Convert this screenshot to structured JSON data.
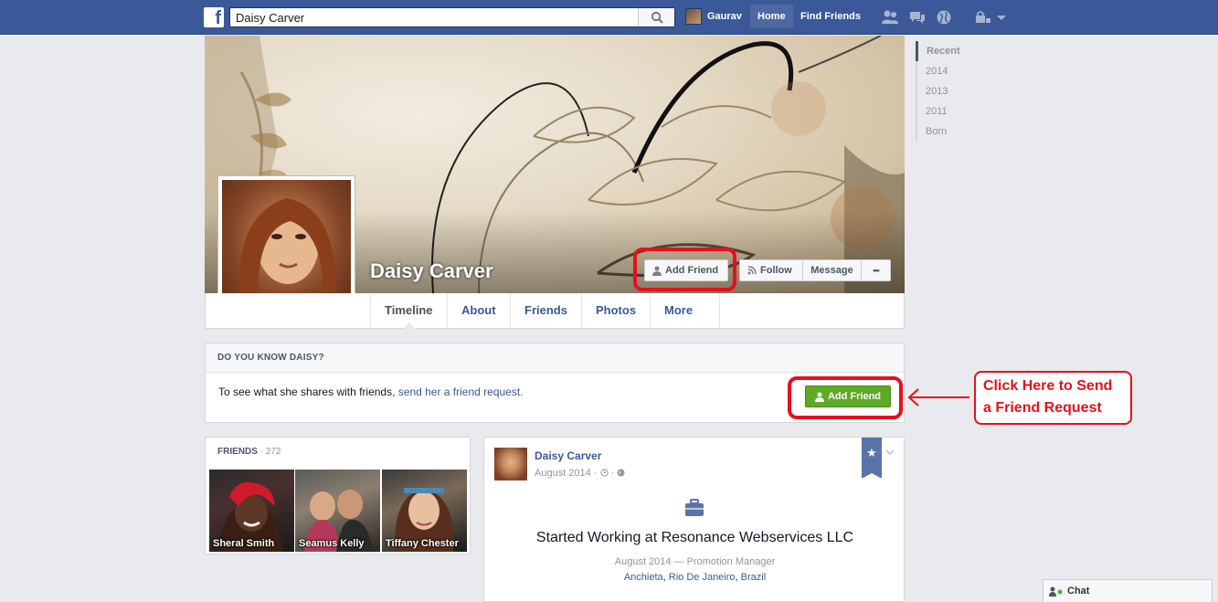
{
  "topbar": {
    "logo": "f",
    "search_value": "Daisy Carver",
    "user_name": "Gaurav",
    "home_label": "Home",
    "find_friends_label": "Find Friends"
  },
  "profile": {
    "name": "Daisy Carver",
    "cover_buttons": {
      "add_friend": "Add Friend",
      "follow": "Follow",
      "message": "Message",
      "more_dots": "•••"
    }
  },
  "tabs": {
    "timeline": "Timeline",
    "about": "About",
    "friends": "Friends",
    "photos": "Photos",
    "more": "More"
  },
  "know_box": {
    "heading": "DO YOU KNOW DAISY?",
    "text": "To see what she shares with friends, ",
    "link": "send her a friend request.",
    "button": "Add Friend"
  },
  "annotation": {
    "line1": "Click Here to Send",
    "line2": "a Friend Request"
  },
  "friends": {
    "heading": "FRIENDS",
    "separator": " · ",
    "count": "272",
    "items": [
      {
        "name": "Sheral Smith"
      },
      {
        "name": "Seamus Kelly"
      },
      {
        "name": "Tiffany Chester"
      }
    ]
  },
  "post": {
    "author": "Daisy Carver",
    "date": "August 2014 · ",
    "title": "Started Working at Resonance Webservices LLC",
    "subtitle": "August 2014 — Promotion Manager",
    "location_city": "Anchieta",
    "location_sep": ", ",
    "location_state": "Rio De Janeiro",
    "location_sep2": ", ",
    "location_country": "Brazil"
  },
  "timeline_years": [
    "Recent",
    "2014",
    "2013",
    "2011",
    "Born"
  ],
  "chat": {
    "label": "Chat"
  },
  "colors": {
    "brand_blue": "#3b5998",
    "highlight_red": "#e4111b",
    "add_friend_green": "#5eaa26"
  }
}
